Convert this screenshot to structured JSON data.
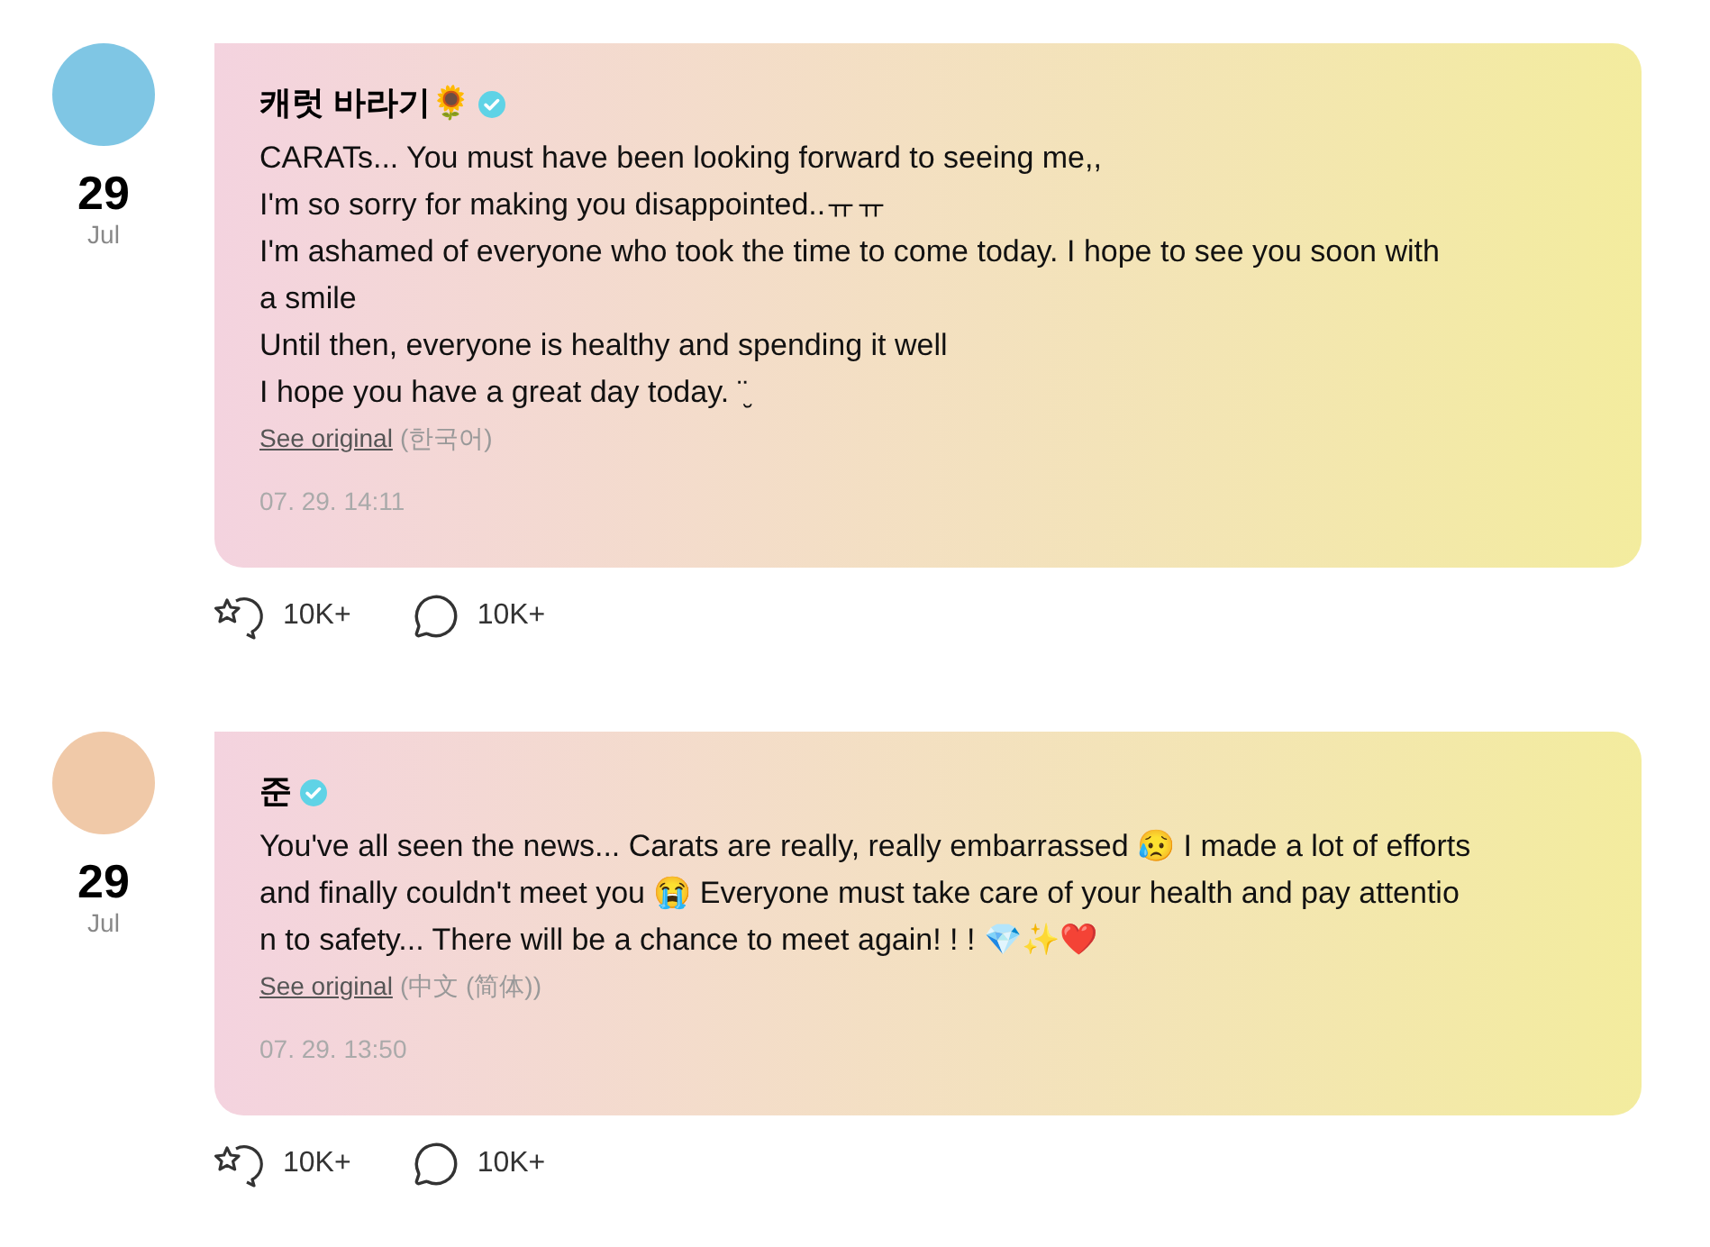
{
  "posts": [
    {
      "author": "캐럿 바라기🌻",
      "verified": true,
      "day": "29",
      "month": "Jul",
      "lines": [
        "CARATs... You must have been looking forward to seeing me,,",
        "I'm so sorry for making you disappointed..ㅠㅠ",
        "I'm ashamed of everyone who took the time to come today. I hope to see you soon with",
        "a smile",
        "Until then, everyone is healthy and spending it well",
        "I hope you have a great day today. ¨̮"
      ],
      "see_original": "See original",
      "language": "(한국어)",
      "timestamp": "07. 29. 14:11",
      "likes": "10K+",
      "comments": "10K+"
    },
    {
      "author": "준",
      "verified": true,
      "day": "29",
      "month": "Jul",
      "lines": [
        "You've all seen the news... Carats are really, really embarrassed 😥 I made a lot of efforts",
        "and finally couldn't meet you 😭 Everyone must take care of your health and pay attentio",
        "n to safety... There will be a chance to meet again!  !  ! 💎✨❤️"
      ],
      "see_original": "See original",
      "language": "(中文 (简体))",
      "timestamp": "07. 29. 13:50",
      "likes": "10K+",
      "comments": "10K+"
    }
  ]
}
